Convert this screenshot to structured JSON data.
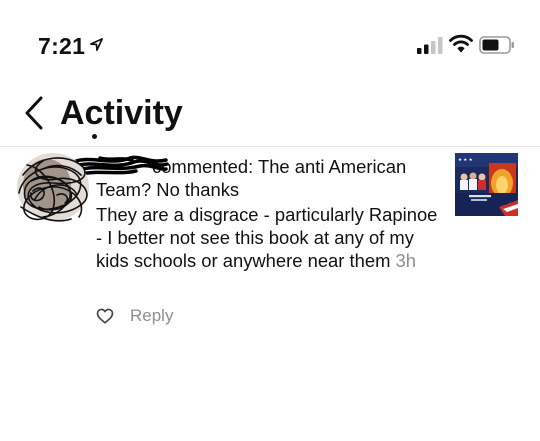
{
  "status_bar": {
    "time": "7:21",
    "icons": [
      "location-arrow-icon",
      "cellular-signal-icon",
      "wifi-icon",
      "battery-icon"
    ]
  },
  "header": {
    "title": "Activity",
    "back_icon": "chevron-left-icon"
  },
  "comment": {
    "header_text": "commented: The anti American Team? No thanks",
    "body_text": "They are a disgrace - particularly Rapinoe - I better not see this book at any of my kids schools or anywhere near them",
    "time_ago": "3h"
  },
  "actions": {
    "like_icon": "heart-outline-icon",
    "reply_label": "Reply"
  },
  "colors": {
    "text": "#121212",
    "secondary": "#8e8e8e",
    "divider": "#e6e6e6"
  }
}
